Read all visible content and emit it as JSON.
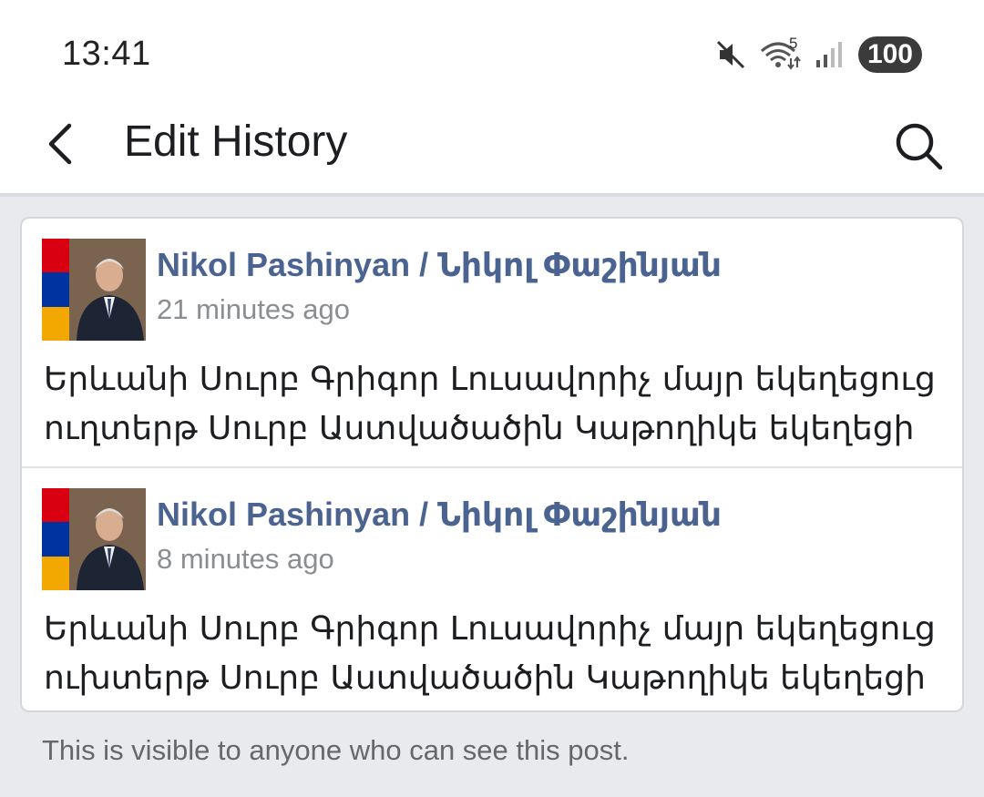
{
  "status_bar": {
    "time": "13:41",
    "icons": [
      "mute-icon",
      "wifi-icon",
      "signal-icon"
    ],
    "wifi_label": "5",
    "battery": "100"
  },
  "app_bar": {
    "title": "Edit History",
    "back_icon": "chevron-left-icon",
    "search_icon": "search-icon"
  },
  "history": [
    {
      "author": "Nikol Pashinyan / Նիկոլ Փաշինյան",
      "time": "21 minutes ago",
      "text": "Երևանի Սուրբ Գրիգոր Լուսավորիչ մայր եկեղեցուց ուղտերթ Սուրբ Աստվածածին Կաթողիկե եկեղեցի"
    },
    {
      "author": "Nikol Pashinyan / Նիկոլ Փաշինյան",
      "time": "8 minutes ago",
      "text": "Երևանի Սուրբ Գրիգոր Լուսավորիչ մայր եկեղեցուց ուխտերթ Սուրբ Աստվածածին Կաթողիկե եկեղեցի"
    }
  ],
  "footer_note": "This is visible to anyone who can see this post.",
  "colors": {
    "author": "#4b6391",
    "background": "#e9eaee",
    "flag_red": "#d90012",
    "flag_blue": "#0033a0",
    "flag_orange": "#f2a800"
  }
}
